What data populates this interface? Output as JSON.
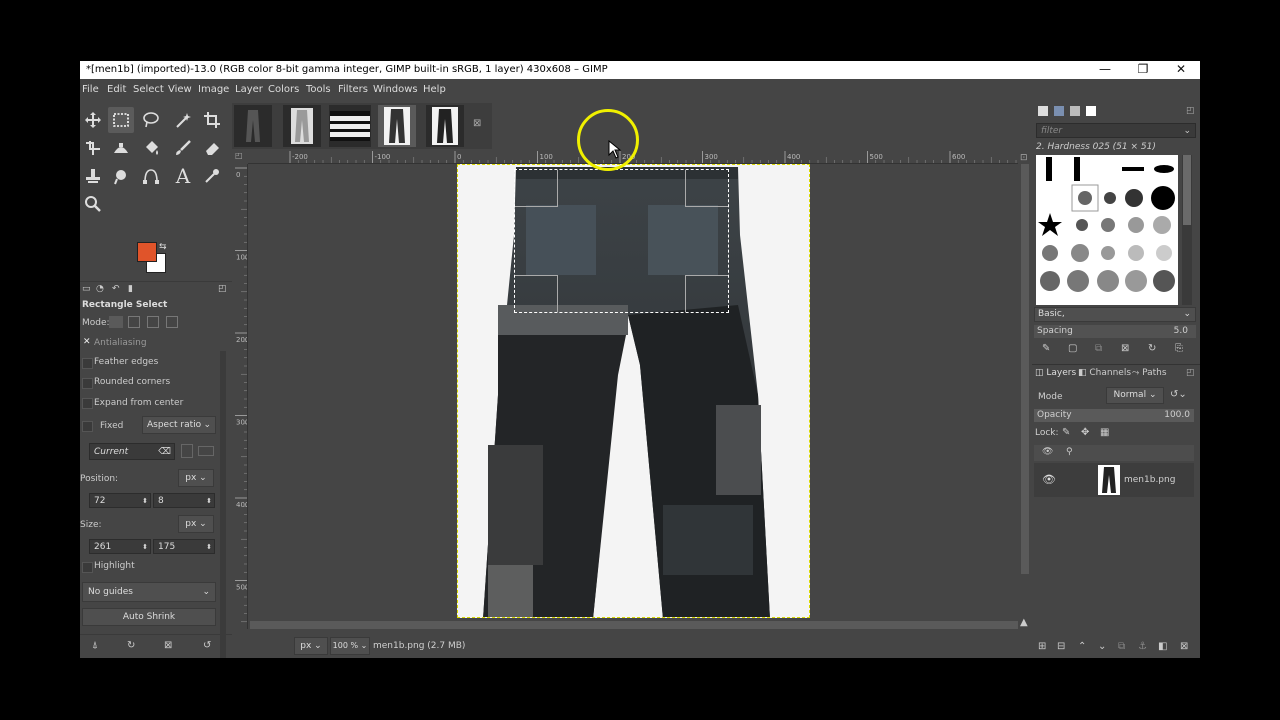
{
  "window": {
    "title": "*[men1b] (imported)-13.0 (RGB color 8-bit gamma integer, GIMP built-in sRGB, 1 layer) 430x608 – GIMP",
    "minimize": "—",
    "maximize": "❐",
    "close": "✕"
  },
  "menubar": [
    "File",
    "Edit",
    "Select",
    "View",
    "Image",
    "Layer",
    "Colors",
    "Tools",
    "Filters",
    "Windows",
    "Help"
  ],
  "tool_options": {
    "title": "Rectangle Select",
    "mode_label": "Mode:",
    "antialiasing": "Antialiasing",
    "feather_edges": "Feather edges",
    "rounded_corners": "Rounded corners",
    "expand_from_center": "Expand from center",
    "fixed": "Fixed",
    "aspect_ratio": "Aspect ratio",
    "current": "Current",
    "position_label": "Position:",
    "position_unit": "px",
    "position_x": "72",
    "position_y": "8",
    "size_label": "Size:",
    "size_unit": "px",
    "size_w": "261",
    "size_h": "175",
    "highlight": "Highlight",
    "guides": "No guides",
    "auto_shrink": "Auto Shrink"
  },
  "rulers": {
    "h_ticks": [
      "-200",
      "-100",
      "0",
      "100",
      "200",
      "300",
      "400",
      "500",
      "600"
    ],
    "v_ticks": [
      "0",
      "100",
      "200",
      "300",
      "400",
      "500"
    ]
  },
  "statusbar": {
    "unit": "px",
    "zoom": "100 %",
    "file_info": "men1b.png (2.7 MB)"
  },
  "brushes": {
    "filter_placeholder": "filter",
    "current_brush": "2. Hardness 025 (51 × 51)",
    "preset": "Basic,",
    "spacing_label": "Spacing",
    "spacing_value": "5.0"
  },
  "layers": {
    "tabs": [
      "Layers",
      "Channels",
      "Paths"
    ],
    "mode_label": "Mode",
    "mode_value": "Normal",
    "opacity_label": "Opacity",
    "opacity_value": "100.0",
    "lock_label": "Lock:",
    "layer_name": "men1b.png"
  },
  "colors": {
    "foreground": "#e0542a",
    "background": "#ffffff",
    "cursor_ring": "#f0f000"
  }
}
